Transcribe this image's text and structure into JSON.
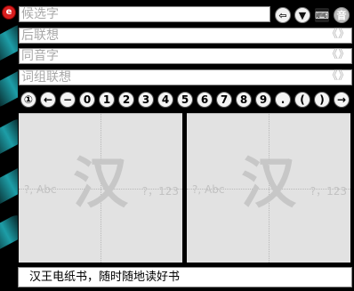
{
  "candidate": {
    "placeholder": "候选字"
  },
  "association": {
    "placeholder": "后联想"
  },
  "homophone": {
    "placeholder": "同音字"
  },
  "phrase": {
    "placeholder": "词组联想"
  },
  "chevron_glyph": "《》",
  "toolbar": {
    "back_symbol": "⇦",
    "dropdown_symbol": "▼",
    "keyboard_symbol": "⌨",
    "sound_label": "音"
  },
  "symbols": [
    "①",
    "←",
    "−",
    "0",
    "1",
    "2",
    "3",
    "4",
    "5",
    "6",
    "7",
    "8",
    "9",
    ".",
    "(",
    ")",
    "→"
  ],
  "pads": [
    {
      "big": "汉",
      "hint_left": "?, Abc",
      "hint_right": "?，123"
    },
    {
      "big": "汉",
      "hint_left": "?, Abc",
      "hint_right": "?，123"
    }
  ],
  "status": {
    "text": "汉王电纸书，随时随地读好书"
  },
  "colors": {
    "logo": "#d81e1e",
    "accent": "#1fa6b0",
    "pad": "#e2e2e2"
  }
}
